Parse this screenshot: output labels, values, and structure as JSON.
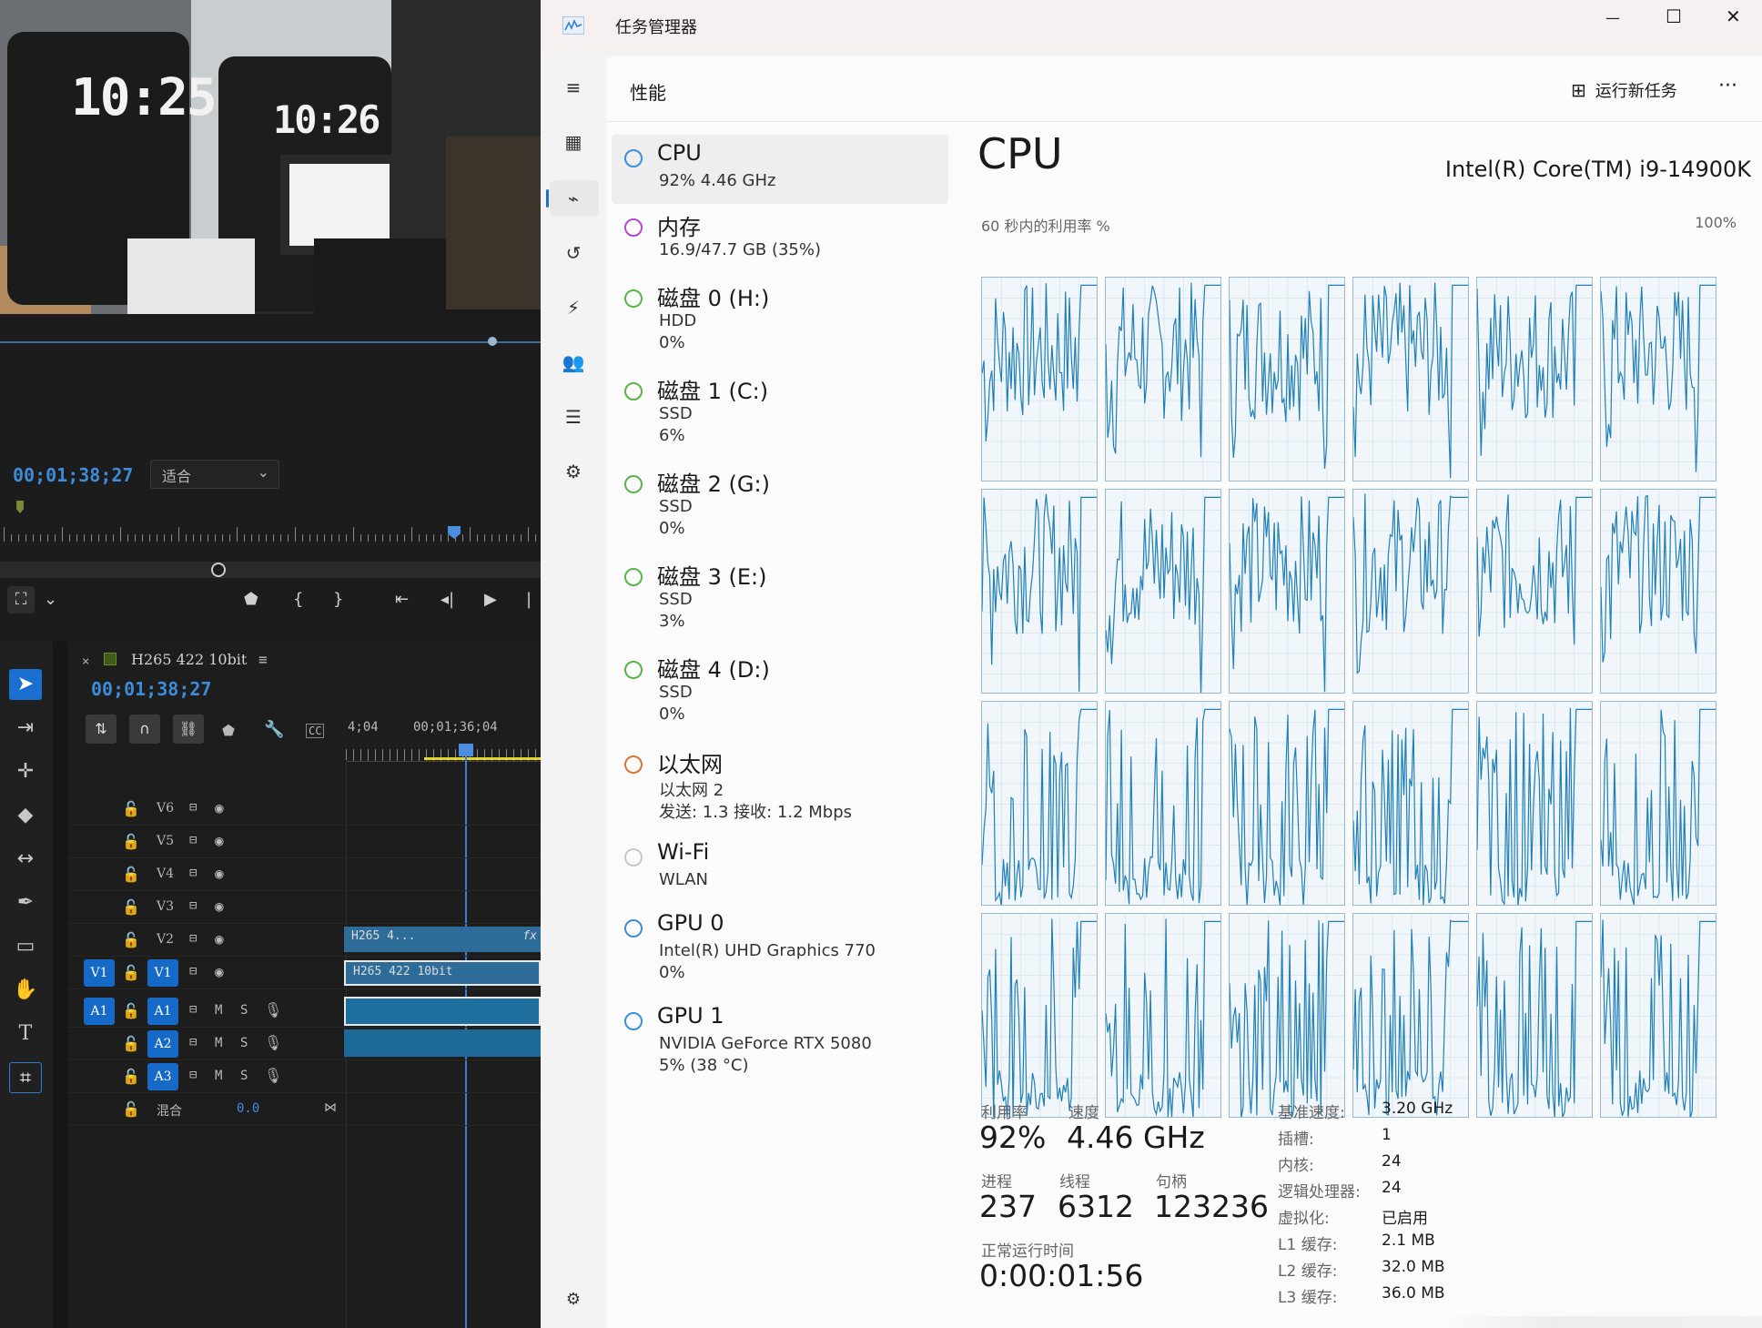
{
  "premiere": {
    "preview_clocks": [
      "10:25",
      "10:26"
    ],
    "monitor": {
      "timecode": "00;01;38;27",
      "zoom_select": "适合"
    },
    "sequence": {
      "close": "×",
      "name": "H265 422 10bit",
      "menu": "≡",
      "timecode": "00;01;38;27",
      "ruler_labels": [
        "4;04",
        "00;01;36;04"
      ],
      "video_tracks": [
        "V6",
        "V5",
        "V4",
        "V3",
        "V2",
        "V1"
      ],
      "v1_source_tag": "V1",
      "audio_tracks": [
        "A1",
        "A2",
        "A3"
      ],
      "a1_source_tag": "A1",
      "audio_mute": "M",
      "audio_solo": "S",
      "mix_label": "混合",
      "mix_value": "0.0",
      "clips": {
        "v2": "H265 4...",
        "v2_fx": "fx",
        "v1": "H265 422 10bit"
      }
    }
  },
  "taskmanager": {
    "title": "任务管理器",
    "page_title": "性能",
    "run_new_task": "运行新任务",
    "more": "···",
    "window_controls": {
      "minimize": "—",
      "maximize": "☐",
      "close": "✕"
    },
    "devices": [
      {
        "name": "CPU",
        "lines": [
          "92%  4.46 GHz"
        ],
        "ring": "#3b8fd6",
        "selected": true
      },
      {
        "name": "内存",
        "lines": [
          "16.9/47.7 GB (35%)"
        ],
        "ring": "#b04cc7"
      },
      {
        "name": "磁盘 0 (H:)",
        "lines": [
          "HDD",
          "0%"
        ],
        "ring": "#5ab44a"
      },
      {
        "name": "磁盘 1 (C:)",
        "lines": [
          "SSD",
          "6%"
        ],
        "ring": "#5ab44a"
      },
      {
        "name": "磁盘 2 (G:)",
        "lines": [
          "SSD",
          "0%"
        ],
        "ring": "#5ab44a"
      },
      {
        "name": "磁盘 3 (E:)",
        "lines": [
          "SSD",
          "3%"
        ],
        "ring": "#5ab44a"
      },
      {
        "name": "磁盘 4 (D:)",
        "lines": [
          "SSD",
          "0%"
        ],
        "ring": "#5ab44a"
      },
      {
        "name": "以太网",
        "lines": [
          "以太网 2",
          "发送: 1.3  接收: 1.2 Mbps"
        ],
        "ring": "#d4763a"
      },
      {
        "name": "Wi-Fi",
        "lines": [
          "WLAN"
        ],
        "ring": "#c8c8c8"
      },
      {
        "name": "GPU 0",
        "lines": [
          "Intel(R) UHD Graphics 770",
          "0%"
        ],
        "ring": "#3b8fd6"
      },
      {
        "name": "GPU 1",
        "lines": [
          "NVIDIA GeForce RTX 5080",
          "5% (38 °C)"
        ],
        "ring": "#3b8fd6"
      }
    ],
    "cpu": {
      "heading": "CPU",
      "model": "Intel(R) Core(TM) i9-14900K",
      "graph_caption": "60 秒内的利用率 %",
      "graph_max": "100%",
      "graph_line_color": "#1f7fb8",
      "utilization_label": "利用率",
      "utilization": "92%",
      "speed_label": "速度",
      "speed": "4.46 GHz",
      "processes_label": "进程",
      "processes": "237",
      "threads_label": "线程",
      "threads": "6312",
      "handles_label": "句柄",
      "handles": "123236",
      "uptime_label": "正常运行时间",
      "uptime": "0:00:01:56",
      "specs": [
        {
          "k": "基准速度:",
          "v": "3.20 GHz"
        },
        {
          "k": "插槽:",
          "v": "1"
        },
        {
          "k": "内核:",
          "v": "24"
        },
        {
          "k": "逻辑处理器:",
          "v": "24"
        },
        {
          "k": "虚拟化:",
          "v": "已启用"
        },
        {
          "k": "L1 缓存:",
          "v": "2.1 MB"
        },
        {
          "k": "L2 缓存:",
          "v": "32.0 MB"
        },
        {
          "k": "L3 缓存:",
          "v": "36.0 MB"
        }
      ]
    }
  }
}
